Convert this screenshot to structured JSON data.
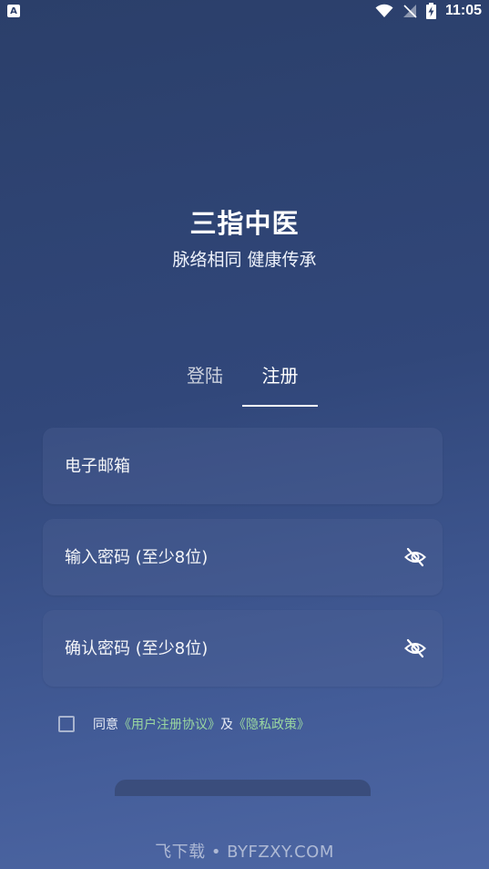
{
  "status_bar": {
    "app_badge": "A",
    "time": "11:05",
    "icons": [
      "wifi-icon",
      "no-signal-icon",
      "battery-charging-icon"
    ]
  },
  "brand": {
    "title": "三指中医",
    "slogan": "脉络相同 健康传承"
  },
  "tabs": {
    "login": "登陆",
    "register": "注册",
    "active": "register"
  },
  "form": {
    "email_placeholder": "电子邮箱",
    "password_placeholder": "输入密码 (至少8位)",
    "confirm_placeholder": "确认密码 (至少8位)",
    "password_toggle_icon": "eye-off-icon"
  },
  "agreement": {
    "prefix": "同意",
    "terms_link": "《用户注册协议》",
    "and": "及",
    "privacy_link": "《隐私政策》"
  },
  "watermark": "飞下载 • BYFZXY.COM",
  "colors": {
    "link": "#9ad7a0",
    "background_top": "#2b3f6a",
    "background_bottom": "#4e67a4"
  }
}
